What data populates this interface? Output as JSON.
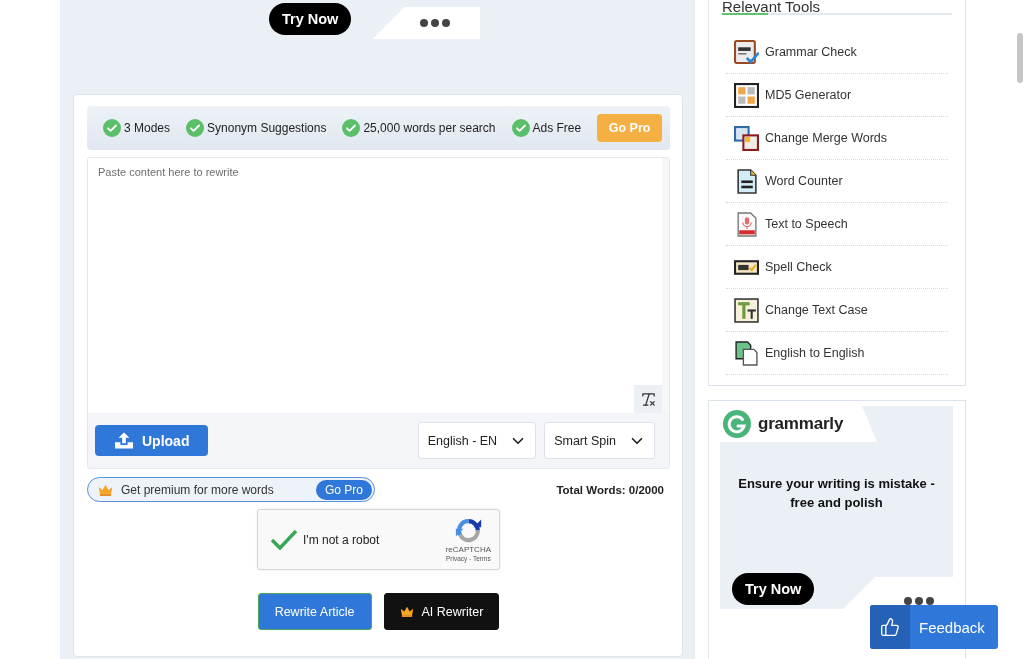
{
  "top_ad": {
    "button": "Try Now"
  },
  "features": {
    "items": [
      "3 Modes",
      "Synonym Suggestions",
      "25,000 words per search",
      "Ads Free"
    ],
    "button": "Go Pro"
  },
  "editor": {
    "placeholder": "Paste content here to rewrite",
    "upload": "Upload",
    "selects": [
      {
        "value": "English - EN"
      },
      {
        "value": "Smart Spin"
      }
    ]
  },
  "premium": {
    "text": "Get premium for more words",
    "button": "Go Pro"
  },
  "total_words": "Total Words: 0/2000",
  "captcha": {
    "label": "I'm not a robot",
    "checked": true,
    "brand": "reCAPTCHA",
    "links": "Privacy - Terms"
  },
  "actions": [
    {
      "label": "Rewrite Article",
      "kind": "primary"
    },
    {
      "label": "AI Rewriter",
      "kind": "premium"
    }
  ],
  "sidebar": {
    "title": "Relevant Tools",
    "tools": [
      "Grammar Check",
      "MD5 Generator",
      "Change Merge Words",
      "Word Counter",
      "Text to Speech",
      "Spell Check",
      "Change Text Case",
      "English to English"
    ]
  },
  "ad": {
    "brand": "grammarly",
    "headline": "Ensure your writing is mistake - free and polish",
    "button": "Try Now"
  },
  "feedback": "Feedback"
}
